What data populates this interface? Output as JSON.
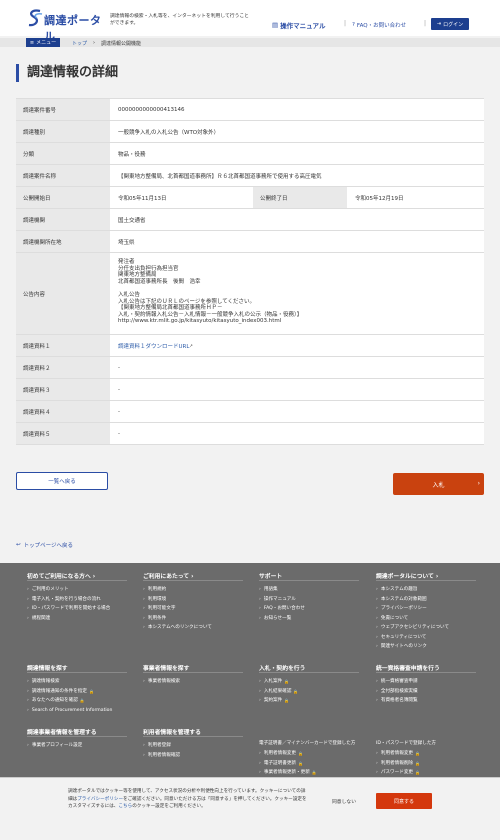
{
  "header": {
    "logo_text": "調達ポータル",
    "tagline": "調達情報の検索・入札等を、インターネットを利用して行うことができます。",
    "manual_label": "操作マニュアル",
    "faq_label": "FAQ・お問い合わせ",
    "login_label": "ログイン"
  },
  "breadcrumb": {
    "menu_label": "メニュー",
    "items": [
      "トップ",
      "調達情報公開機能"
    ]
  },
  "page_title": "調達情報の詳細",
  "detail": {
    "case_no": {
      "label": "調達案件番号",
      "value": "0000000000000413146"
    },
    "type": {
      "label": "調達種別",
      "value": "一般競争入札の入札公告（WTO対象外）"
    },
    "category": {
      "label": "分類",
      "value": "物品・役務"
    },
    "case_name": {
      "label": "調達案件名称",
      "value": "【関東地方整備局、北首都国道事務所】Ｒ６北首都国道事務所で使用する高圧電気"
    },
    "pub_start": {
      "label": "公開開始日",
      "value": "令和05年11月13日"
    },
    "pub_end": {
      "label": "公開終了日",
      "value": "令和05年12月19日"
    },
    "agency": {
      "label": "調達機関",
      "value": "国土交通省"
    },
    "location": {
      "label": "調達機関所在地",
      "value": "埼玉県"
    },
    "notice": {
      "label": "公告内容",
      "value": "発注者\n分任支出負担行為担当官\n関東地方整備局\n北首都国道事務所長　後間　浩幸\n\n入札公告\n入札公告は下記のＵＲＬのページを参照してください。\n【関東地方整備局北首都国道事務所ＨＰ－\n入札・契約情報入札公告－入札情報－一般競争入札の公示（物品・役務）】\nhttp://www.ktr.mlit.go.jp/kitasyuto/kitasyuto_index003.html"
    },
    "doc1": {
      "label": "調達資料１",
      "value": "調達資料１ダウンロードURL"
    },
    "doc2": {
      "label": "調達資料２",
      "value": "-"
    },
    "doc3": {
      "label": "調達資料３",
      "value": "-"
    },
    "doc4": {
      "label": "調達資料４",
      "value": "-"
    },
    "doc5": {
      "label": "調達資料５",
      "value": "-"
    }
  },
  "buttons": {
    "back": "一覧へ戻る",
    "bid": "入札"
  },
  "toplink": "トップページへ戻る",
  "footer": {
    "col1": {
      "title": "初めてご利用になる方へ",
      "items": [
        "ご利用のメリット",
        "電子入札・契約を行う場合の流れ",
        "ID・パスワードで利用を開始する場合",
        "",
        "規程関連"
      ]
    },
    "col2": {
      "title": "ご利用にあたって",
      "items": [
        "利用規約",
        "利用環境",
        "利用可能文字",
        "利用条件",
        "本システムへのリンクについて"
      ]
    },
    "col3": {
      "title": "サポート",
      "items": [
        "用語集",
        "操作マニュアル",
        "FAQ・お問い合わせ",
        "お知らせ一覧"
      ]
    },
    "col4": {
      "title": "調達ポータルについて",
      "items": [
        "本システムの趣旨",
        "本システムの対象範囲",
        "プライバシーポリシー",
        "免責について",
        "ウェブアクセシビリティについて",
        "セキュリティについて",
        "関連サイトへのリンク"
      ]
    },
    "col5": {
      "title": "調達情報を探す",
      "items": [
        "調達情報検索",
        "調達情報通知の条件を指定",
        "あなたへの通知を確認",
        "Search of Procurement Information"
      ]
    },
    "col6": {
      "title": "事業者情報を探す",
      "items": [
        "事業者情報検索"
      ]
    },
    "col7": {
      "title": "入札・契約を行う",
      "items": [
        "入札案件",
        "入札結果確認",
        "契約案件"
      ]
    },
    "col8": {
      "title": "統一資格審査申請を行う",
      "items": [
        "統一資格審査申請",
        "全付部指検索実績",
        "有資格者名簿閲覧"
      ]
    },
    "col9": {
      "title": "調達事業者情報を管理する",
      "items": [
        "事業者プロフィール設定"
      ]
    },
    "col10": {
      "title": "利用者情報を管理する",
      "items": [
        "利用者登録",
        "利用者情報確認"
      ]
    },
    "col11": {
      "title": "",
      "sub": "電子証明書／マイナンバーカードで登録した方",
      "items": [
        "利用者情報変更",
        "電子証明書更新",
        "事業者情報更新・更新",
        "委任状作成・承認"
      ]
    },
    "col12": {
      "title": "",
      "sub": "ID・パスワードで登録した方",
      "items": [
        "利用者情報変更",
        "利用者情報削除",
        "パスワード変更",
        "パスワード初期化"
      ]
    }
  },
  "cookie": {
    "text_a": "調達ポータルではクッキー等を使用して、アクセス状況の分析や利便性向上を行っています。クッキーについての詳細は",
    "policy_link": "プライバシーポリシー",
    "text_b": "をご確認ください。同意いただける方は「同意する」を押してください。クッキー設定をカスタマイズするには、",
    "settings_link": "こちら",
    "text_c": "のクッキー設定をご利用ください。",
    "disagree": "同意しない",
    "agree": "同意する"
  },
  "colors": {
    "brand": "#2b4da5",
    "accent": "#c9420f",
    "footer": "#6b6b6b"
  }
}
